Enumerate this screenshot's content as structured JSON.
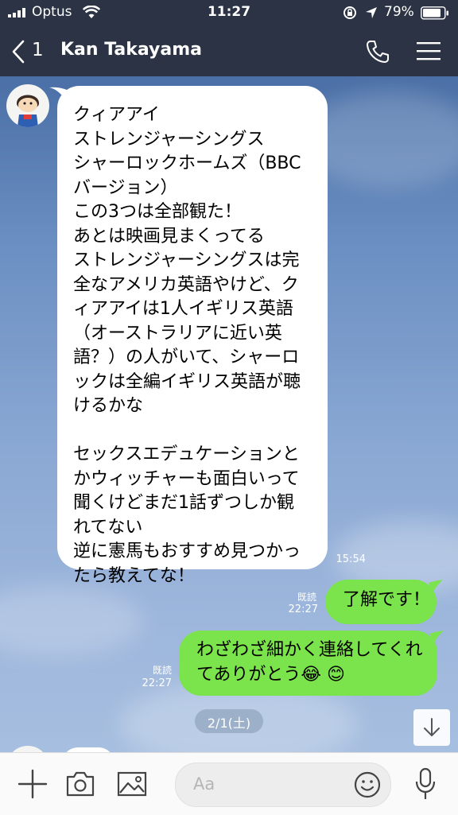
{
  "status_bar": {
    "carrier": "Optus",
    "time": "11:27",
    "battery": "79%",
    "icons": [
      "signal-icon",
      "wifi-icon",
      "rotation-lock-icon",
      "location-icon",
      "battery-icon"
    ]
  },
  "header": {
    "back_count": "1",
    "title": "Kan Takayama",
    "icons": [
      "back-chevron-icon",
      "phone-icon",
      "menu-icon"
    ]
  },
  "messages": [
    {
      "direction": "incoming",
      "text": "クィアアイ\nストレンジャーシングス\nシャーロックホームズ（BBC\nバージョン）\nこの3つは全部観た！\nあとは映画見まくってる\nストレンジャーシングスは完\n全なアメリカ英語やけど、ク\nィアアイは1人イギリス英語\n（オーストラリアに近い英\n語？）の人がいて、シャーロ\nックは全編イギリス英語が聴\nけるかな\n\nセックスエデュケーションと\nかウィッチャーも面白いって\n聞くけどまだ1話ずつしか観\nれてない\n逆に憲馬もおすすめ見つかっ\nたら教えてな！",
      "time": "15:54"
    },
    {
      "direction": "outgoing",
      "text": "了解です！",
      "read": "既読",
      "time": "22:27"
    },
    {
      "direction": "outgoing",
      "text": "わざわざ細かく連絡してくれ\nてありがとう😂 😊",
      "read": "既読",
      "time": "22:27"
    }
  ],
  "date_separator": "2/1(土)",
  "input_bar": {
    "placeholder": "Aa",
    "icons": [
      "plus-icon",
      "camera-icon",
      "image-icon",
      "emoji-icon",
      "microphone-icon"
    ]
  },
  "colors": {
    "header_bg": "#2b3344",
    "outgoing_bubble": "#7be34b",
    "incoming_bubble": "#ffffff"
  }
}
